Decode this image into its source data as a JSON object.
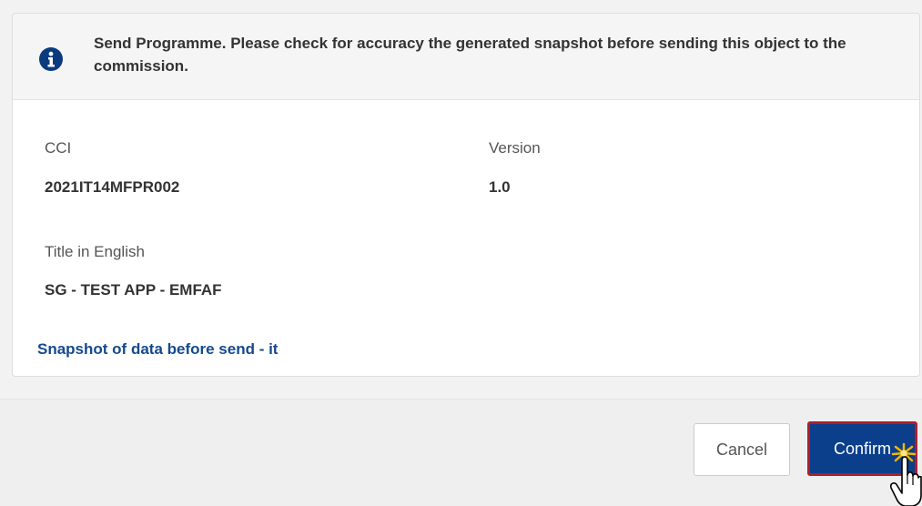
{
  "dialog": {
    "message": "Send Programme. Please check for accuracy the generated snapshot before sending this object to the commission.",
    "fields": {
      "cci_label": "CCI",
      "cci_value": "2021IT14MFPR002",
      "version_label": "Version",
      "version_value": "1.0",
      "title_label": "Title in English",
      "title_value": "SG - TEST APP - EMFAF"
    },
    "snapshot_link": "Snapshot of data before send - it"
  },
  "buttons": {
    "cancel_label": "Cancel",
    "confirm_label": "Confirm"
  },
  "icons": {
    "info": "info-icon",
    "cursor": "hand-pointer-icon"
  },
  "colors": {
    "primary": "#0b3f8c",
    "highlight_border": "#b01d2b",
    "link": "#144a8c"
  }
}
